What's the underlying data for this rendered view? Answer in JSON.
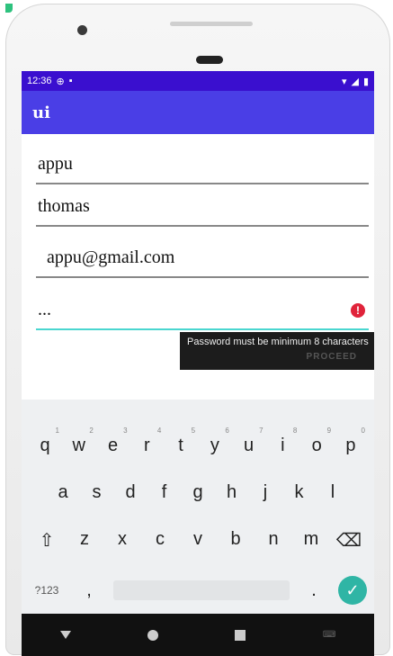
{
  "status_bar": {
    "time": "12:36"
  },
  "app_bar": {
    "title": "ui"
  },
  "form": {
    "first_name": "appu",
    "last_name": "thomas",
    "email": "appu@gmail.com",
    "password_mask": "..."
  },
  "error": {
    "message": "Password must be minimum 8 characters",
    "ghost_button": "PROCEED"
  },
  "keyboard": {
    "row1": [
      {
        "key": "q",
        "hint": "1"
      },
      {
        "key": "w",
        "hint": "2"
      },
      {
        "key": "e",
        "hint": "3"
      },
      {
        "key": "r",
        "hint": "4"
      },
      {
        "key": "t",
        "hint": "5"
      },
      {
        "key": "y",
        "hint": "6"
      },
      {
        "key": "u",
        "hint": "7"
      },
      {
        "key": "i",
        "hint": "8"
      },
      {
        "key": "o",
        "hint": "9"
      },
      {
        "key": "p",
        "hint": "0"
      }
    ],
    "row2": [
      "a",
      "s",
      "d",
      "f",
      "g",
      "h",
      "j",
      "k",
      "l"
    ],
    "row3": [
      "z",
      "x",
      "c",
      "v",
      "b",
      "n",
      "m"
    ],
    "symbols_label": "?123",
    "comma": ",",
    "period": "."
  },
  "icons": {
    "shift": "shift-icon",
    "backspace": "backspace-icon",
    "enter": "check-icon"
  },
  "colors": {
    "status_bar": "#3a0fcf",
    "app_bar": "#4a3ee6",
    "field_focus": "#4ad6d0",
    "error": "#e0233a",
    "enter_key": "#2fb5a5"
  }
}
